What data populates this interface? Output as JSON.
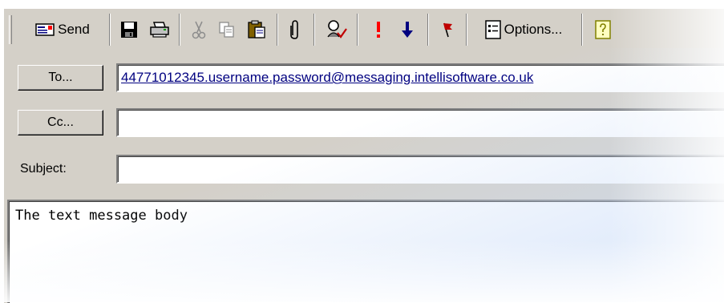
{
  "toolbar": {
    "send_label": "Send",
    "options_label": "Options...",
    "icons": {
      "send": "envelope-icon",
      "save": "floppy-disk-icon",
      "print": "printer-icon",
      "cut": "scissors-icon",
      "copy": "copy-icon",
      "paste": "clipboard-icon",
      "attach": "paperclip-icon",
      "check_names": "check-names-icon",
      "importance_high": "exclamation-icon",
      "importance_low": "down-arrow-icon",
      "flag": "flag-icon",
      "options": "options-icon",
      "help": "help-icon"
    }
  },
  "recipients": {
    "to_button": "To...",
    "to_value": "44771012345.username.password@messaging.intellisoftware.co.uk",
    "cc_button": "Cc...",
    "cc_value": "",
    "subject_label": "Subject:",
    "subject_value": ""
  },
  "message": {
    "body": "The text message body"
  },
  "colors": {
    "chrome": "#d4d0c8",
    "high_importance": "#ff0000",
    "low_importance": "#000080"
  }
}
